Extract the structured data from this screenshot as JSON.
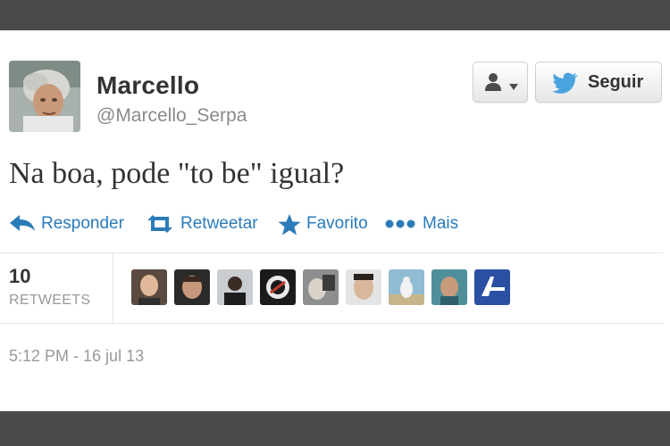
{
  "user": {
    "name": "Marcello",
    "handle": "@Marcello_Serpa"
  },
  "buttons": {
    "follow_label": "Seguir"
  },
  "tweet": {
    "text": "Na boa, pode \"to be\" igual?",
    "timestamp": "5:12 PM - 16 jul 13"
  },
  "actions": {
    "reply": "Responder",
    "retweet": "Retweetar",
    "favorite": "Favorito",
    "more": "Mais"
  },
  "stats": {
    "retweet_count": "10",
    "retweet_label": "RETWEETS"
  },
  "retweeter_avatars": [
    "avatar-1",
    "avatar-2",
    "avatar-3",
    "avatar-4",
    "avatar-5",
    "avatar-6",
    "avatar-7",
    "avatar-8",
    "avatar-9"
  ],
  "icons": {
    "reply": "reply-arrow-icon",
    "retweet": "retweet-icon",
    "favorite": "star-icon",
    "more": "ellipsis-icon",
    "user": "user-icon",
    "caret": "caret-down-icon",
    "bird": "twitter-bird-icon"
  },
  "colors": {
    "link_blue": "#2b7bb9",
    "bird_blue": "#4aa3df",
    "text_dark": "#333333",
    "text_gray": "#999999",
    "frame_bar": "#4a4a4a"
  }
}
